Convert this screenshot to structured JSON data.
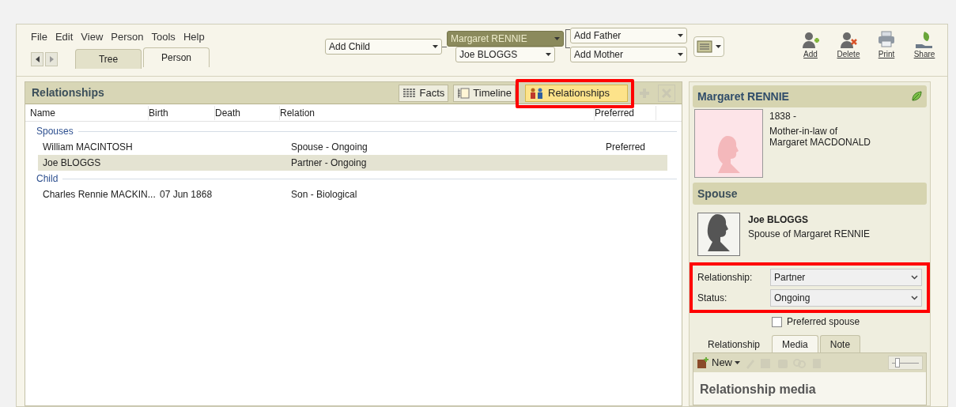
{
  "menu": [
    "File",
    "Edit",
    "View",
    "Person",
    "Tools",
    "Help"
  ],
  "view_tabs": [
    {
      "label": "Tree",
      "selected": false
    },
    {
      "label": "Person",
      "selected": true
    }
  ],
  "navigator": {
    "child": "Add Child",
    "person": "Margaret RENNIE",
    "spouse": "Joe BLOGGS",
    "father": "Add Father",
    "mother": "Add Mother"
  },
  "toolbar_actions": [
    {
      "kind": "add",
      "label": "Add"
    },
    {
      "kind": "delete",
      "label": "Delete"
    },
    {
      "kind": "print",
      "label": "Print"
    },
    {
      "kind": "share",
      "label": "Share"
    }
  ],
  "panel": {
    "title": "Relationships",
    "view_buttons": [
      {
        "kind": "facts",
        "label": "Facts",
        "selected": false,
        "highlighted": false
      },
      {
        "kind": "timeline",
        "label": "Timeline",
        "selected": false,
        "highlighted": false
      },
      {
        "kind": "relationships",
        "label": "Relationships",
        "selected": true,
        "highlighted": true
      }
    ],
    "columns": [
      "Name",
      "Birth",
      "Death",
      "Relation",
      "Preferred"
    ],
    "groups": [
      {
        "title": "Spouses",
        "rows": [
          {
            "name": "William MACINTOSH",
            "birth": "",
            "death": "",
            "relation": "Spouse - Ongoing",
            "preferred": "Preferred",
            "selected": false
          },
          {
            "name": "Joe BLOGGS",
            "birth": "",
            "death": "",
            "relation": "Partner - Ongoing",
            "preferred": "",
            "selected": true
          }
        ]
      },
      {
        "title": "Child",
        "rows": [
          {
            "name": "Charles Rennie MACKIN...",
            "birth": "07 Jun 1868",
            "death": "",
            "relation": "Son - Biological",
            "preferred": "",
            "selected": false
          }
        ]
      }
    ]
  },
  "person_card": {
    "name": "Margaret RENNIE",
    "dates": "1838 -",
    "note_lines": [
      "Mother-in-law of",
      "Margaret MACDONALD"
    ]
  },
  "spouse": {
    "title": "Spouse",
    "name": "Joe BLOGGS",
    "description": "Spouse of Margaret RENNIE",
    "fields": [
      {
        "label": "Relationship:",
        "value": "Partner"
      },
      {
        "label": "Status:",
        "value": "Ongoing"
      }
    ],
    "highlighted": true,
    "preferred": {
      "label": "Preferred spouse",
      "checked": false
    },
    "tabs": [
      {
        "label": "Relationship",
        "selected": false
      },
      {
        "label": "Media",
        "selected": true
      },
      {
        "label": "Note",
        "selected": false
      }
    ],
    "new_button": "New",
    "media_zoom": {
      "level": 0.2
    },
    "media_title": "Relationship media"
  }
}
